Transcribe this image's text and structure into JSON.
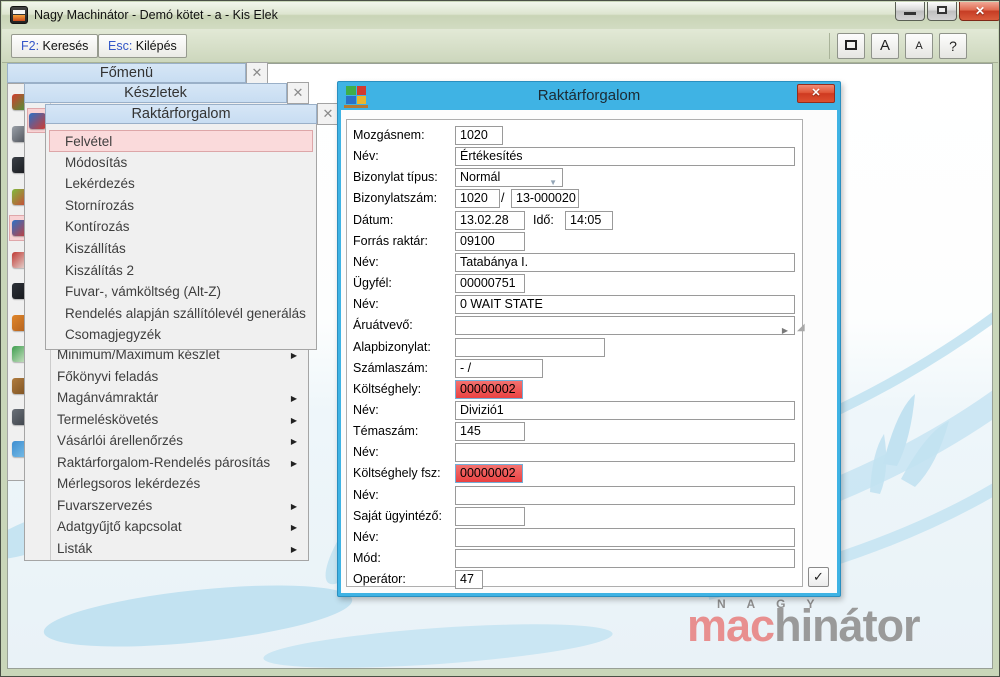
{
  "window": {
    "title": "Nagy Machinátor - Demó kötet - a - Kis Elek",
    "close_glyph": "✕"
  },
  "toolbar": {
    "search_key": "F2:",
    "search_label": " Keresés",
    "exit_key": "Esc:",
    "exit_label": " Kilépés",
    "font_big": "A",
    "font_small": "A",
    "help": "?"
  },
  "menus": {
    "fomenu": {
      "title": "Főmenü",
      "close_glyph": "✕",
      "icons": [
        {
          "name": "tomato",
          "c1": "#d23c2e",
          "c2": "#3f9e3a"
        },
        {
          "name": "handtruck",
          "c1": "#9aa0a8",
          "c2": "#4a4e55"
        },
        {
          "name": "monitor",
          "c1": "#3a3f46",
          "c2": "#17191d"
        },
        {
          "name": "apple",
          "c1": "#7fba3c",
          "c2": "#d04038"
        },
        {
          "name": "pallet",
          "c1": "#2a71c8",
          "c2": "#d23b30",
          "selected": true
        },
        {
          "name": "cart",
          "c1": "#c03a34",
          "c2": "#e8e6e2"
        },
        {
          "name": "screen",
          "c1": "#2d3138",
          "c2": "#14161a"
        },
        {
          "name": "basket",
          "c1": "#e0862a",
          "c2": "#b05f1e"
        },
        {
          "name": "money",
          "c1": "#3e9e4e",
          "c2": "#d8e8d0"
        },
        {
          "name": "package",
          "c1": "#b07c3f",
          "c2": "#7a4f20"
        },
        {
          "name": "printer",
          "c1": "#6a7078",
          "c2": "#3c4148"
        },
        {
          "name": "globe",
          "c1": "#3e8ed0",
          "c2": "#7cc0e8"
        }
      ]
    },
    "keszletek": {
      "title": "Készletek",
      "close_glyph": "✕",
      "items": [
        {
          "label": "Minimum/Maximum készlet",
          "submenu": true
        },
        {
          "label": "Főkönyvi feladás",
          "submenu": false
        },
        {
          "label": "Magánvámraktár",
          "submenu": true
        },
        {
          "label": "Termeléskövetés",
          "submenu": true
        },
        {
          "label": "Vásárlói árellenőrzés",
          "submenu": true
        },
        {
          "label": "Raktárforgalom-Rendelés párosítás",
          "submenu": true
        },
        {
          "label": "Mérlegsoros lekérdezés",
          "submenu": false
        },
        {
          "label": "Fuvarszervezés",
          "submenu": true
        },
        {
          "label": "Adatgyűjtő kapcsolat",
          "submenu": true
        },
        {
          "label": "Listák",
          "submenu": true
        }
      ]
    },
    "raktarforgalom": {
      "title": "Raktárforgalom",
      "close_glyph": "✕",
      "items": [
        {
          "label": "Felvétel",
          "selected": true
        },
        {
          "label": "Módosítás"
        },
        {
          "label": "Lekérdezés"
        },
        {
          "label": "Stornírozás"
        },
        {
          "label": "Kontírozás"
        },
        {
          "label": "Kiszállítás"
        },
        {
          "label": "Kiszálítás 2"
        },
        {
          "label": "Fuvar-, vámköltség (Alt-Z)"
        },
        {
          "label": "Rendelés alapján szállítólevél generálás"
        },
        {
          "label": "Csomagjegyzék"
        }
      ]
    }
  },
  "dialog": {
    "title": "Raktárforgalom",
    "close_glyph": "✕",
    "confirm_glyph": "✓",
    "fields": [
      {
        "id": "mozgasnem",
        "label": "Mozgásnem:",
        "value": "1020",
        "kind": "code4"
      },
      {
        "id": "nev1",
        "label": "Név:",
        "value": "Értékesítés",
        "kind": "wide"
      },
      {
        "id": "bizonylat_tipus",
        "label": "Bizonylat típus:",
        "value": "Normál",
        "kind": "dropdown"
      },
      {
        "id": "bizonylatszam",
        "label": "Bizonylatszám:",
        "value": "1020",
        "separator": "/",
        "value2": "13-000020",
        "kind": "pair"
      },
      {
        "id": "datum",
        "label": "Dátum:",
        "value": "13.02.28",
        "label2": "Idő:",
        "value2": "14:05",
        "kind": "datetime"
      },
      {
        "id": "forras_raktar",
        "label": "Forrás raktár:",
        "value": "09100",
        "kind": "code5"
      },
      {
        "id": "nev2",
        "label": "Név:",
        "value": "Tatabánya I.",
        "kind": "wide"
      },
      {
        "id": "ugyfel",
        "label": "Ügyfél:",
        "value": "00000751",
        "kind": "code5"
      },
      {
        "id": "nev3",
        "label": "Név:",
        "value": "0 WAIT STATE",
        "kind": "wide"
      },
      {
        "id": "aruatvevo",
        "label": "Áruátvevő:",
        "value": "",
        "kind": "widearrow"
      },
      {
        "id": "alapbizonylat",
        "label": "Alapbizonylat:",
        "value": "",
        "kind": "medium"
      },
      {
        "id": "szamlaszam",
        "label": "Számlaszám:",
        "value": "-  /",
        "kind": "msmall"
      },
      {
        "id": "koltseghely",
        "label": "Költséghely:",
        "value": "00000002",
        "kind": "red"
      },
      {
        "id": "nev4",
        "label": "Név:",
        "value": "Divizió1",
        "kind": "wide"
      },
      {
        "id": "temaszam",
        "label": "Témaszám:",
        "value": "145",
        "kind": "code5"
      },
      {
        "id": "nev5",
        "label": "Név:",
        "value": "",
        "kind": "wide"
      },
      {
        "id": "koltseghely_fsz",
        "label": "Költséghely fsz:",
        "value": "00000002",
        "kind": "red"
      },
      {
        "id": "nev6",
        "label": "Név:",
        "value": "",
        "kind": "wide"
      },
      {
        "id": "sajat_ugyintezo",
        "label": "Saját ügyintéző:",
        "value": "",
        "kind": "code5"
      },
      {
        "id": "nev7",
        "label": "Név:",
        "value": "",
        "kind": "wide"
      },
      {
        "id": "mod",
        "label": "Mód:",
        "value": "",
        "kind": "wide"
      },
      {
        "id": "operator",
        "label": "Operátor:",
        "value": "47",
        "kind": "tiny"
      }
    ]
  },
  "logo": {
    "top": "N A G Y",
    "accent": "mac",
    "rest": "hinátor"
  },
  "colors": {
    "dialog_titlebar": "#3fb3e4",
    "red_field": "#ea4242",
    "menu_selection": "#fadadb",
    "flourish": "#c2e2f1",
    "logo_accent": "#e88f8f"
  }
}
